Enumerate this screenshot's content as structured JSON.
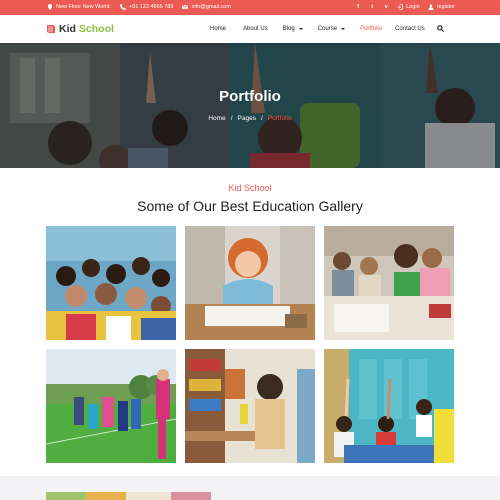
{
  "topbar": {
    "address": "New Floor New World.",
    "phone": "+91 123 4565 789",
    "email": "info@gmail.com",
    "login": "Login",
    "register": "register",
    "social": [
      "facebook-icon",
      "twitter-icon",
      "vimeo-icon"
    ],
    "bg_color": "#ec5b53"
  },
  "nav": {
    "logo_part1": "Kid",
    "logo_part2": "School",
    "items": [
      {
        "label": "Home",
        "dropdown": false,
        "active": false
      },
      {
        "label": "About Us",
        "dropdown": false,
        "active": false
      },
      {
        "label": "Blog",
        "dropdown": true,
        "active": false
      },
      {
        "label": "Course",
        "dropdown": true,
        "active": false
      },
      {
        "label": "Portfolio",
        "dropdown": false,
        "active": true
      },
      {
        "label": "Contact Us",
        "dropdown": false,
        "active": false
      }
    ]
  },
  "hero": {
    "title": "Portfolio",
    "breadcrumb": [
      "Home",
      "Pages",
      "Portfolio"
    ]
  },
  "section": {
    "subtitle": "Kid School",
    "title": "Some of Our Best Education Gallery"
  },
  "gallery": [
    "group-of-kids-photo",
    "girl-drawing-photo",
    "kids-in-classroom-photo",
    "kids-playing-outdoors-photo",
    "kids-in-playroom-photo",
    "classroom-raised-hands-photo"
  ],
  "colors": {
    "accent": "#ec5b53",
    "logo_green": "#8cbf3f"
  }
}
